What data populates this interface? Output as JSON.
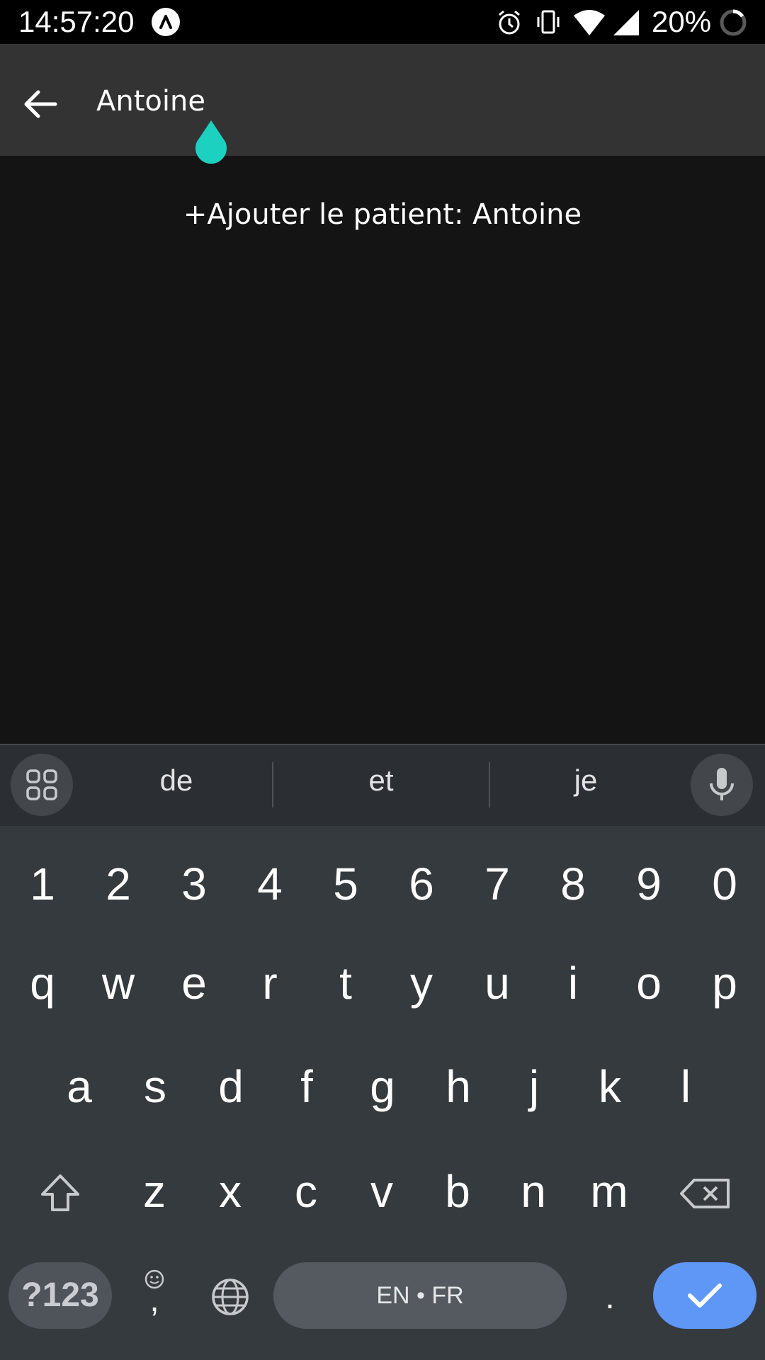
{
  "status_bar": {
    "time": "14:57:20",
    "battery_percent": "20%",
    "icons": [
      "app-notification-icon",
      "alarm-icon",
      "vibrate-icon",
      "wifi-icon",
      "signal-icon",
      "battery-icon"
    ]
  },
  "app_bar": {
    "search_value": "Antoine",
    "back_icon": "arrow-left-icon"
  },
  "results": {
    "add_patient_label": "+Ajouter le patient: Antoine"
  },
  "keyboard": {
    "suggestions": [
      "de",
      "et",
      "je"
    ],
    "number_row": [
      "1",
      "2",
      "3",
      "4",
      "5",
      "6",
      "7",
      "8",
      "9",
      "0"
    ],
    "row1": [
      "q",
      "w",
      "e",
      "r",
      "t",
      "y",
      "u",
      "i",
      "o",
      "p"
    ],
    "row2": [
      "a",
      "s",
      "d",
      "f",
      "g",
      "h",
      "j",
      "k",
      "l"
    ],
    "row3": [
      "z",
      "x",
      "c",
      "v",
      "b",
      "n",
      "m"
    ],
    "symbols_label": "?123",
    "comma_label": ",",
    "period_label": ".",
    "space_label": "EN • FR"
  },
  "colors": {
    "accent": "#1dd1c1",
    "enter_key": "#5e97f6",
    "appbar": "#333333",
    "background": "#141414"
  }
}
